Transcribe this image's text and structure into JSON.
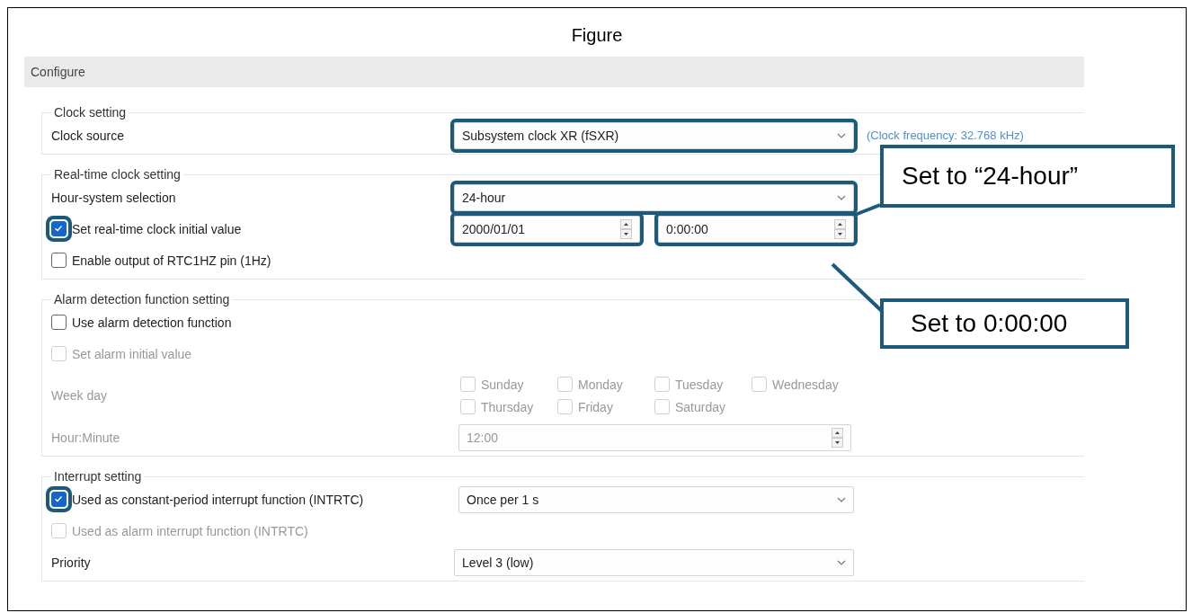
{
  "figure": {
    "title": "Figure"
  },
  "panel": {
    "title": "Configure"
  },
  "groups": [
    {
      "title": "Clock setting",
      "rows": [
        {
          "kind": "combo",
          "label": "Clock source",
          "value": "Subsystem clock XR (fSXR)",
          "highlighted": true,
          "note": "(Clock frequency: 32.768 kHz)"
        }
      ]
    },
    {
      "title": "Real-time clock setting",
      "rows": [
        {
          "kind": "combo",
          "label": "Hour-system selection",
          "value": "24-hour",
          "highlighted": true
        },
        {
          "kind": "check",
          "label": "Set real-time clock initial value",
          "checked": true,
          "disabled": false,
          "highlighted": true,
          "fields": [
            {
              "value": "2000/01/01",
              "highlighted": true
            },
            {
              "value": "0:00:00",
              "highlighted": true
            }
          ]
        },
        {
          "kind": "check",
          "label": "Enable output of RTC1HZ pin (1Hz)",
          "checked": false,
          "disabled": false,
          "highlighted": false
        }
      ]
    },
    {
      "title": "Alarm detection function setting",
      "rows": [
        {
          "kind": "check",
          "label": "Use alarm detection function",
          "checked": false,
          "disabled": false,
          "highlighted": false
        },
        {
          "kind": "check",
          "label": "Set alarm initial value",
          "checked": false,
          "disabled": true,
          "highlighted": false
        },
        {
          "kind": "days",
          "label": "Week day",
          "disabled": true,
          "days": [
            {
              "label": "Sunday",
              "checked": false
            },
            {
              "label": "Monday",
              "checked": false
            },
            {
              "label": "Tuesday",
              "checked": false
            },
            {
              "label": "Wednesday",
              "checked": false
            },
            {
              "label": "Thursday",
              "checked": false
            },
            {
              "label": "Friday",
              "checked": false
            },
            {
              "label": "Saturday",
              "checked": false
            }
          ]
        },
        {
          "kind": "spin",
          "label": "Hour:Minute",
          "value": "12:00",
          "disabled": true
        }
      ]
    },
    {
      "title": "Interrupt setting",
      "rows": [
        {
          "kind": "check",
          "label": "Used as constant-period interrupt function (INTRTC)",
          "checked": true,
          "disabled": false,
          "highlighted": true,
          "combo": {
            "value": "Once per 1 s"
          }
        },
        {
          "kind": "check",
          "label": "Used as alarm interrupt function (INTRTC)",
          "checked": false,
          "disabled": true,
          "highlighted": false
        },
        {
          "kind": "combo",
          "label": "Priority",
          "value": "Level 3 (low)",
          "highlighted": false
        }
      ]
    }
  ],
  "callouts": [
    {
      "text": "Set to “24-hour”"
    },
    {
      "text": "Set to 0:00:00"
    }
  ]
}
